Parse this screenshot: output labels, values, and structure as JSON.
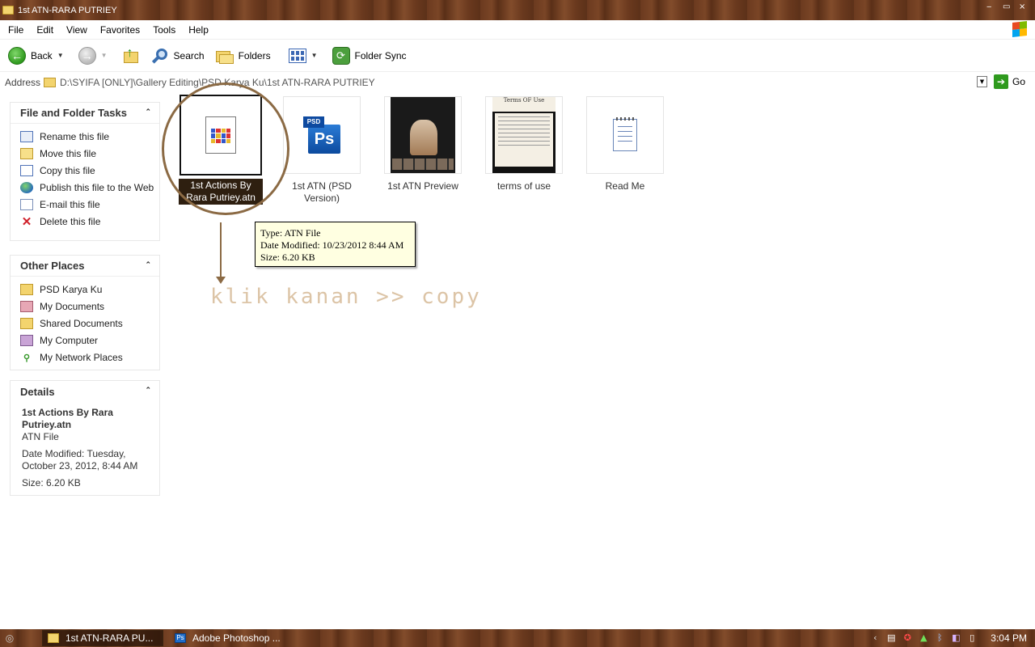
{
  "window": {
    "title": "1st ATN-RARA PUTRIEY",
    "min_glyph": "‒",
    "max_glyph": "▭",
    "close_glyph": "×"
  },
  "menu": [
    "File",
    "Edit",
    "View",
    "Favorites",
    "Tools",
    "Help"
  ],
  "toolbar": {
    "back_label": "Back",
    "search_label": "Search",
    "folders_label": "Folders",
    "foldersync_label": "Folder Sync"
  },
  "address": {
    "label": "Address",
    "path": "D:\\SYIFA [ONLY]\\Gallery Editing\\PSD Karya Ku\\1st ATN-RARA PUTRIEY",
    "go_label": "Go"
  },
  "tasks": {
    "header": "File and Folder Tasks",
    "items": [
      {
        "label": "Rename this file",
        "icon": "rename-icon"
      },
      {
        "label": "Move this file",
        "icon": "move-icon"
      },
      {
        "label": "Copy this file",
        "icon": "copy-icon"
      },
      {
        "label": "Publish this file to the Web",
        "icon": "publish-icon"
      },
      {
        "label": "E-mail this file",
        "icon": "email-icon"
      },
      {
        "label": "Delete this file",
        "icon": "delete-icon"
      }
    ]
  },
  "other_places": {
    "header": "Other Places",
    "items": [
      {
        "label": "PSD Karya Ku",
        "icon": "folder-icon"
      },
      {
        "label": "My Documents",
        "icon": "my-documents-icon"
      },
      {
        "label": "Shared Documents",
        "icon": "folder-icon"
      },
      {
        "label": "My Computer",
        "icon": "my-computer-icon"
      },
      {
        "label": "My Network Places",
        "icon": "network-icon"
      }
    ]
  },
  "details": {
    "header": "Details",
    "name": "1st Actions By Rara Putriey.atn",
    "type": "ATN File",
    "modified": "Date Modified: Tuesday, October 23, 2012, 8:44 AM",
    "size": "Size: 6.20 KB"
  },
  "files": [
    {
      "label": "1st Actions By Rara Putriey.atn",
      "selected": true
    },
    {
      "label": "1st ATN (PSD Version)",
      "selected": false
    },
    {
      "label": "1st ATN Preview",
      "selected": false
    },
    {
      "label": "terms of use",
      "selected": false
    },
    {
      "label": "Read Me",
      "selected": false
    }
  ],
  "thumb_text": {
    "psd_tag": "PSD",
    "psd_mark": "Ps",
    "terms_heading": "Terms OF Use"
  },
  "tooltip": {
    "type": "Type: ATN File",
    "modified": "Date Modified: 10/23/2012 8:44 AM",
    "size": "Size: 6.20 KB"
  },
  "annotation": {
    "text": "klik kanan >> copy"
  },
  "taskbar": {
    "tasks": [
      "1st ATN-RARA PU...",
      "Adobe Photoshop ..."
    ],
    "clock": "3:04 PM"
  },
  "colors": {
    "wood": "#6b3a1f",
    "annotation": "#8b6a44",
    "tooltip_bg": "#ffffe1"
  }
}
